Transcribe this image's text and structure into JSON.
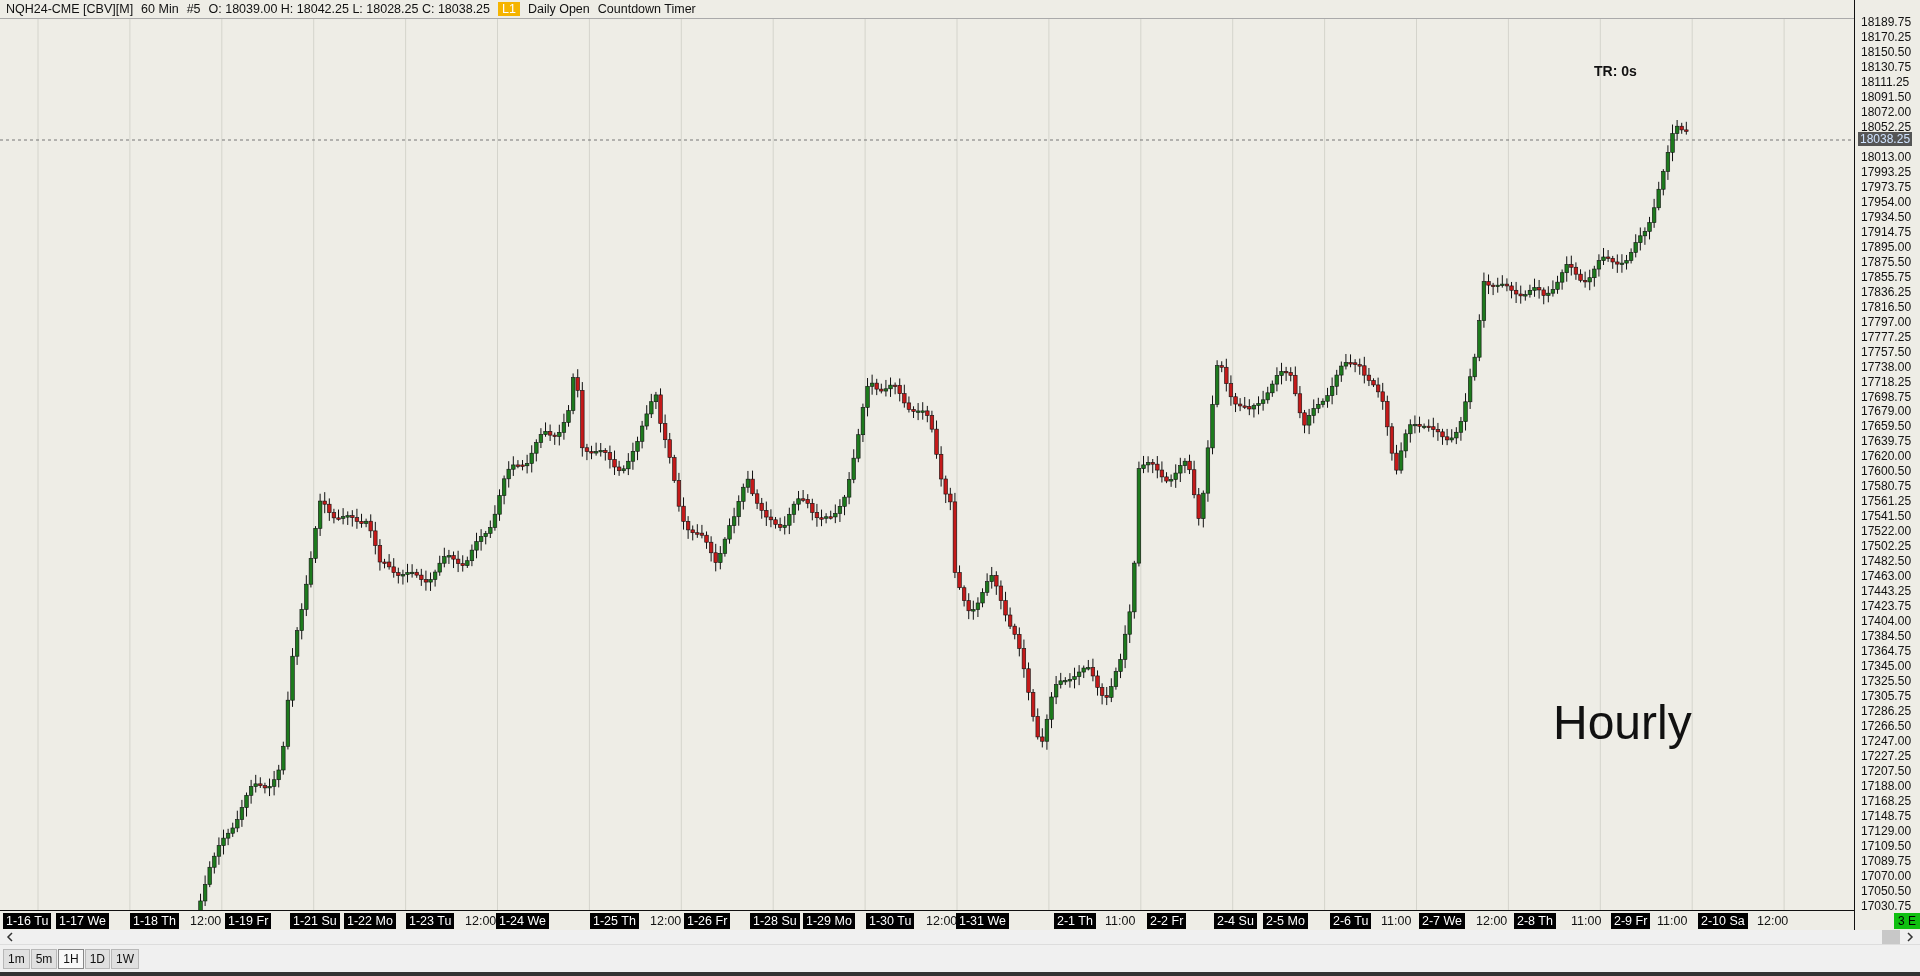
{
  "header": {
    "symbol": "NQH24-CME [CBV][M]",
    "interval": "60 Min",
    "bar_number": "#5",
    "ohlc": "O: 18039.00 H: 18042.25 L: 18028.25 C: 18038.25",
    "badge": "L1",
    "studies": [
      "Daily Open",
      "Countdown Timer"
    ]
  },
  "chart": {
    "timer_label": "TR: 0s",
    "note": "Hourly",
    "current_price": "18038.25",
    "price_axis": [
      "18189.75",
      "18170.25",
      "18150.50",
      "18130.75",
      "18111.25",
      "18091.50",
      "18072.00",
      "18052.25",
      "18013.00",
      "17993.25",
      "17973.75",
      "17954.00",
      "17934.50",
      "17914.75",
      "17895.00",
      "17875.50",
      "17855.75",
      "17836.25",
      "17816.50",
      "17797.00",
      "17777.25",
      "17757.50",
      "17738.00",
      "17718.25",
      "17698.75",
      "17679.00",
      "17659.50",
      "17639.75",
      "17620.00",
      "17600.50",
      "17580.75",
      "17561.25",
      "17541.50",
      "17522.00",
      "17502.25",
      "17482.50",
      "17463.00",
      "17443.25",
      "17423.75",
      "17404.00",
      "17384.50",
      "17364.75",
      "17345.00",
      "17325.50",
      "17305.75",
      "17286.25",
      "17266.50",
      "17247.00",
      "17227.25",
      "17207.50",
      "17188.00",
      "17168.25",
      "17148.75",
      "17129.00",
      "17109.50",
      "17089.75",
      "17070.00",
      "17050.50",
      "17030.75"
    ],
    "time_axis": [
      {
        "text": "1-16 Tu",
        "kind": "date"
      },
      {
        "text": "1-17 We",
        "kind": "date"
      },
      {
        "text": "1-18 Th",
        "kind": "date"
      },
      {
        "text": "12:00",
        "kind": "time"
      },
      {
        "text": "1-19 Fr",
        "kind": "date"
      },
      {
        "text": "1-21 Su",
        "kind": "date"
      },
      {
        "text": "1-22 Mo",
        "kind": "date"
      },
      {
        "text": "1-23 Tu",
        "kind": "date"
      },
      {
        "text": "12:00",
        "kind": "time"
      },
      {
        "text": "1-24 We",
        "kind": "date"
      },
      {
        "text": "1-25 Th",
        "kind": "date"
      },
      {
        "text": "12:00",
        "kind": "time"
      },
      {
        "text": "1-26 Fr",
        "kind": "date"
      },
      {
        "text": "1-28 Su",
        "kind": "date"
      },
      {
        "text": "1-29 Mo",
        "kind": "date"
      },
      {
        "text": "1-30 Tu",
        "kind": "date"
      },
      {
        "text": "12:00",
        "kind": "time"
      },
      {
        "text": "1-31 We",
        "kind": "date"
      },
      {
        "text": "2-1 Th",
        "kind": "date"
      },
      {
        "text": "11:00",
        "kind": "time"
      },
      {
        "text": "2-2 Fr",
        "kind": "date"
      },
      {
        "text": "2-4 Su",
        "kind": "date"
      },
      {
        "text": "2-5 Mo",
        "kind": "date"
      },
      {
        "text": "2-6 Tu",
        "kind": "date"
      },
      {
        "text": "11:00",
        "kind": "time"
      },
      {
        "text": "2-7 We",
        "kind": "date"
      },
      {
        "text": "12:00",
        "kind": "time"
      },
      {
        "text": "2-8 Th",
        "kind": "date"
      },
      {
        "text": "11:00",
        "kind": "time"
      },
      {
        "text": "2-9 Fr",
        "kind": "date"
      },
      {
        "text": "11:00",
        "kind": "time"
      },
      {
        "text": "2-10 Sa",
        "kind": "date"
      },
      {
        "text": "12:00",
        "kind": "time"
      }
    ]
  },
  "status_badge": "3 E",
  "timeframe_tabs": [
    {
      "label": "1m",
      "selected": false
    },
    {
      "label": "5m",
      "selected": false
    },
    {
      "label": "1H",
      "selected": true
    },
    {
      "label": "1D",
      "selected": false
    },
    {
      "label": "1W",
      "selected": false
    }
  ]
}
